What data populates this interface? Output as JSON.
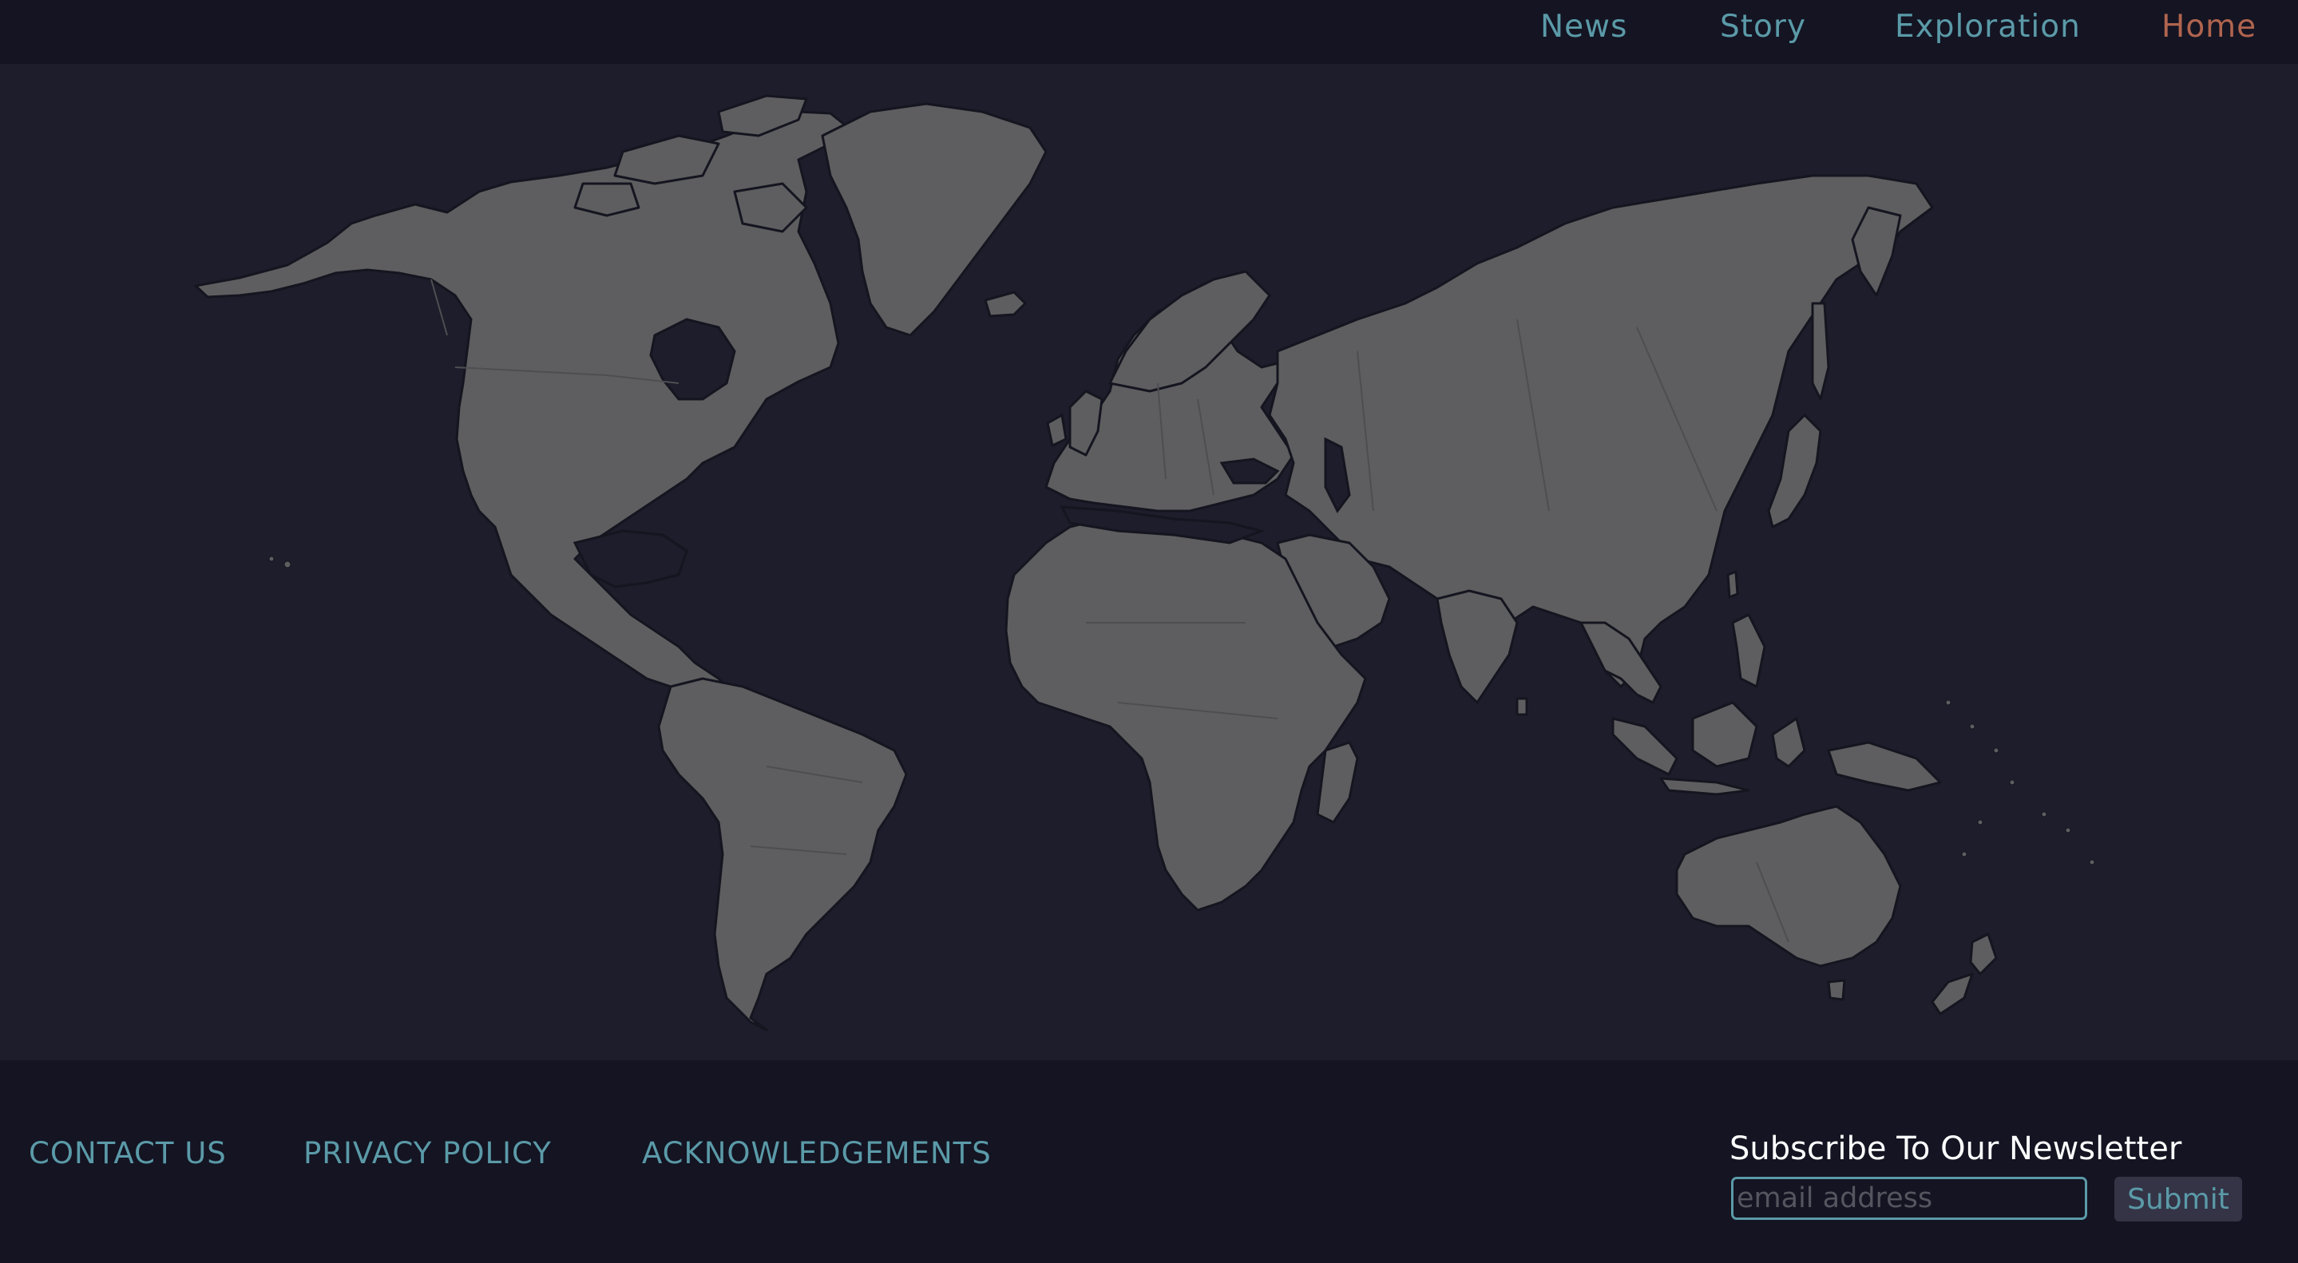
{
  "nav": {
    "links": [
      {
        "label": "News",
        "active": false
      },
      {
        "label": "Story",
        "active": false
      },
      {
        "label": "Exploration",
        "active": false
      },
      {
        "label": "Home",
        "active": true
      }
    ]
  },
  "map": {
    "land_color": "#5e5e60",
    "ocean_color": "#1d1d2b"
  },
  "footer": {
    "links": [
      "CONTACT US",
      "PRIVACY POLICY",
      "ACKNOWLEDGEMENTS"
    ],
    "newsletter": {
      "title": "Subscribe To Our Newsletter",
      "email_placeholder": "email address",
      "submit_label": "Submit"
    }
  },
  "colors": {
    "nav_bg": "#141422",
    "page_bg": "#1d1d2b",
    "link": "#5b9aa8",
    "active_link": "#b0644e",
    "white": "#ffffff"
  }
}
